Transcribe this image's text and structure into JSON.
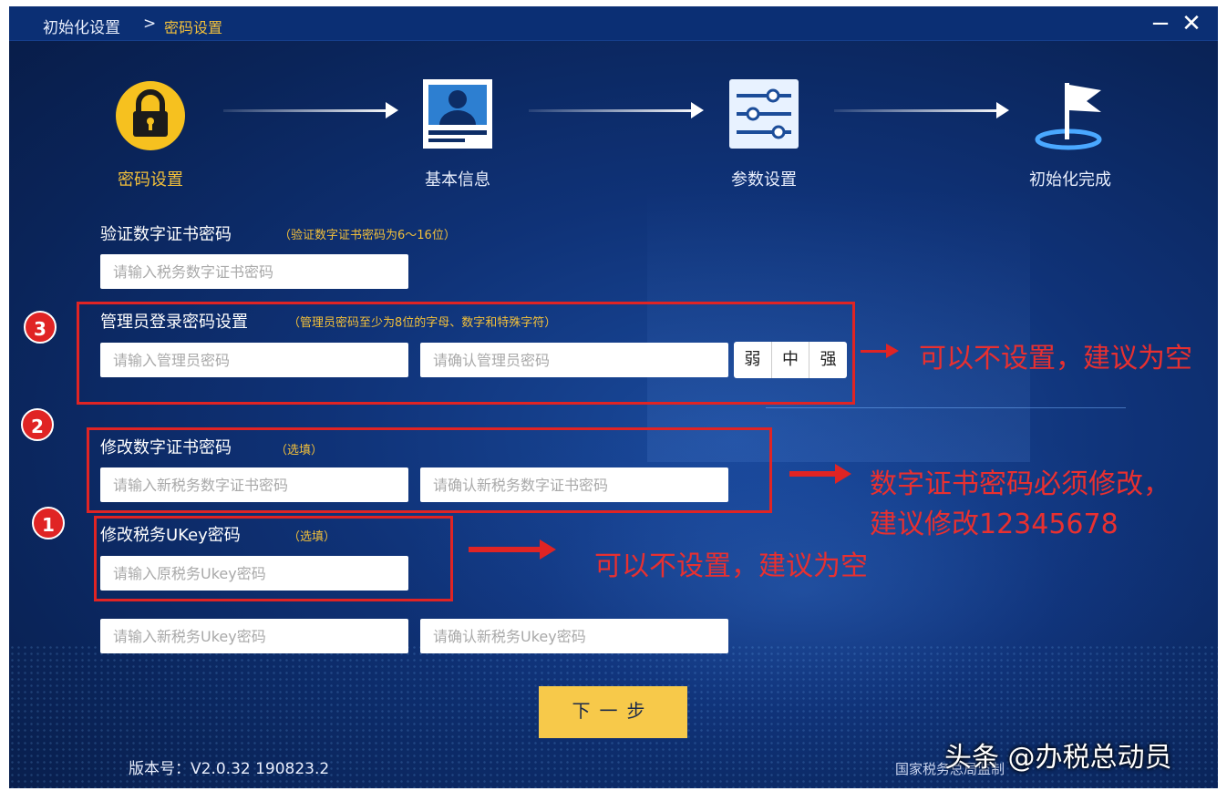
{
  "title_bar": {
    "crumb_root": "初始化设置",
    "crumb_separator": ">",
    "crumb_current": "密码设置",
    "minimize": "−",
    "close": "✕"
  },
  "steps": [
    {
      "label": "密码设置",
      "icon": "lock-icon",
      "active": true
    },
    {
      "label": "基本信息",
      "icon": "id-card-icon",
      "active": false
    },
    {
      "label": "参数设置",
      "icon": "sliders-icon",
      "active": false
    },
    {
      "label": "初始化完成",
      "icon": "flag-icon",
      "active": false
    }
  ],
  "cert_verify": {
    "label": "验证数字证书密码",
    "hint": "（验证数字证书密码为6～16位）",
    "placeholder": "请输入税务数字证书密码"
  },
  "admin": {
    "label": "管理员登录密码设置",
    "hint": "（管理员密码至少为8位的字母、数字和特殊字符）",
    "placeholder": "请输入管理员密码",
    "confirm_placeholder": "请确认管理员密码",
    "strength": [
      "弱",
      "中",
      "强"
    ]
  },
  "cert_change": {
    "label": "修改数字证书密码",
    "hint": "（选填）",
    "placeholder": "请输入新税务数字证书密码",
    "confirm_placeholder": "请确认新税务数字证书密码"
  },
  "ukey": {
    "label": "修改税务UKey密码",
    "hint": "（选填）",
    "old_placeholder": "请输入原税务Ukey密码",
    "new_placeholder": "请输入新税务Ukey密码",
    "confirm_placeholder": "请确认新税务Ukey密码"
  },
  "next_button": "下一步",
  "version": "版本号：V2.0.32 190823.2",
  "org": "国家税务总局监制",
  "annotations": {
    "badge_3": "3",
    "badge_2": "2",
    "badge_1": "1",
    "note_admin": "可以不设置，建议为空",
    "note_cert_line1": "数字证书密码必须修改，",
    "note_cert_line2": "建议修改12345678",
    "note_ukey": "可以不设置，建议为空",
    "color": "#e02424"
  },
  "watermark": "头条 @办税总动员",
  "colors": {
    "background": "#0f3277",
    "accent": "#f3c03a",
    "button": "#f7c94a"
  }
}
